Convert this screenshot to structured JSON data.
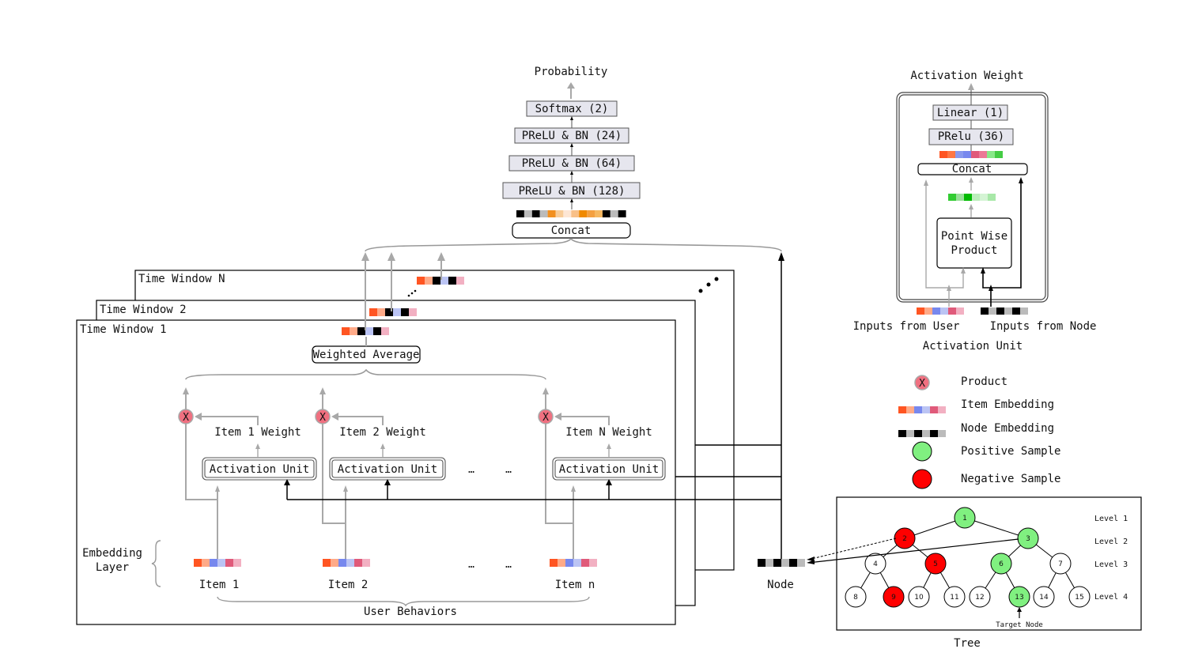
{
  "colors": {
    "item_embedding": [
      "#ff5522",
      "#ffaa88",
      "#7788ee",
      "#bbc4f4",
      "#e05a7a",
      "#f2b0c2"
    ],
    "node_embedding": [
      "#000000",
      "#bbbbbb",
      "#000000",
      "#bbbbbb",
      "#000000",
      "#bbbbbb"
    ],
    "window_embedding": [
      "#ff5522",
      "#ffaa88",
      "#000000",
      "#bbc4f4",
      "#000000",
      "#f2b0c2"
    ],
    "concat_embedding": [
      "#000000",
      "#bbbbbb",
      "#000000",
      "#bbbbbb",
      "#f29020",
      "#f8cc98",
      "#fde6d4",
      "#f8c088",
      "#f08a00",
      "#f4a040",
      "#f6b860",
      "#000000",
      "#bbbbbb",
      "#000000"
    ],
    "au_concat_embedding": [
      "#ff5522",
      "#ff7744",
      "#8899ee",
      "#7788ee",
      "#e05a7a",
      "#ec7896",
      "#88e888",
      "#44cc44"
    ],
    "au_product_embedding": [
      "#33cc33",
      "#99e099",
      "#00bb00",
      "#bbeebb",
      "#d4f4d4",
      "#a8e8a8"
    ],
    "product": "#f07080",
    "positive": "#80f080",
    "negative": "#ff0000",
    "connector_gray": "#a8a8a8"
  },
  "top_stack": {
    "output_label": "Probability",
    "layers": [
      "Softmax (2)",
      "PReLU & BN (24)",
      "PReLU & BN (64)",
      "PReLU & BN (128)"
    ],
    "concat_label": "Concat"
  },
  "time_windows": {
    "labels": [
      "Time Window N",
      "Time Window 2",
      "Time Window 1"
    ],
    "weighted_average": "Weighted Average",
    "ellipsis": "..."
  },
  "behaviors": {
    "items": [
      {
        "weight_label": "Item 1 Weight",
        "unit_label": "Activation Unit",
        "item_label": "Item 1"
      },
      {
        "weight_label": "Item 2 Weight",
        "unit_label": "Activation Unit",
        "item_label": "Item 2"
      },
      {
        "weight_label": "Item N Weight",
        "unit_label": "Activation Unit",
        "item_label": "Item n"
      }
    ],
    "product_symbol": "X",
    "ellipsis": "…",
    "embedding_layer_label": [
      "Embedding",
      "Layer"
    ],
    "group_label": "User Behaviors"
  },
  "node": {
    "label": "Node"
  },
  "activation_unit_detail": {
    "output_label": "Activation Weight",
    "layers": [
      "Linear (1)",
      "PRelu (36)"
    ],
    "concat_label": "Concat",
    "product_label": [
      "Point Wise",
      "Product"
    ],
    "input_user_label": "Inputs from User",
    "input_node_label": "Inputs from Node",
    "caption": "Activation Unit"
  },
  "legend": [
    {
      "kind": "product",
      "label": "Product"
    },
    {
      "kind": "item",
      "label": "Item Embedding"
    },
    {
      "kind": "node",
      "label": "Node Embedding"
    },
    {
      "kind": "positive",
      "label": "Positive Sample"
    },
    {
      "kind": "negative",
      "label": "Negative Sample"
    }
  ],
  "tree": {
    "caption": "Tree",
    "target_label": "Target Node",
    "level_labels": [
      "Level 1",
      "Level 2",
      "Level 3",
      "Level 4"
    ],
    "nodes": [
      {
        "id": "1",
        "state": "positive"
      },
      {
        "id": "2",
        "state": "negative"
      },
      {
        "id": "3",
        "state": "positive"
      },
      {
        "id": "4",
        "state": "none"
      },
      {
        "id": "5",
        "state": "negative"
      },
      {
        "id": "6",
        "state": "positive"
      },
      {
        "id": "7",
        "state": "none"
      },
      {
        "id": "8",
        "state": "none"
      },
      {
        "id": "9",
        "state": "negative"
      },
      {
        "id": "10",
        "state": "none"
      },
      {
        "id": "11",
        "state": "none"
      },
      {
        "id": "12",
        "state": "none"
      },
      {
        "id": "13",
        "state": "positive"
      },
      {
        "id": "14",
        "state": "none"
      },
      {
        "id": "15",
        "state": "none"
      }
    ],
    "target_node": "13"
  }
}
